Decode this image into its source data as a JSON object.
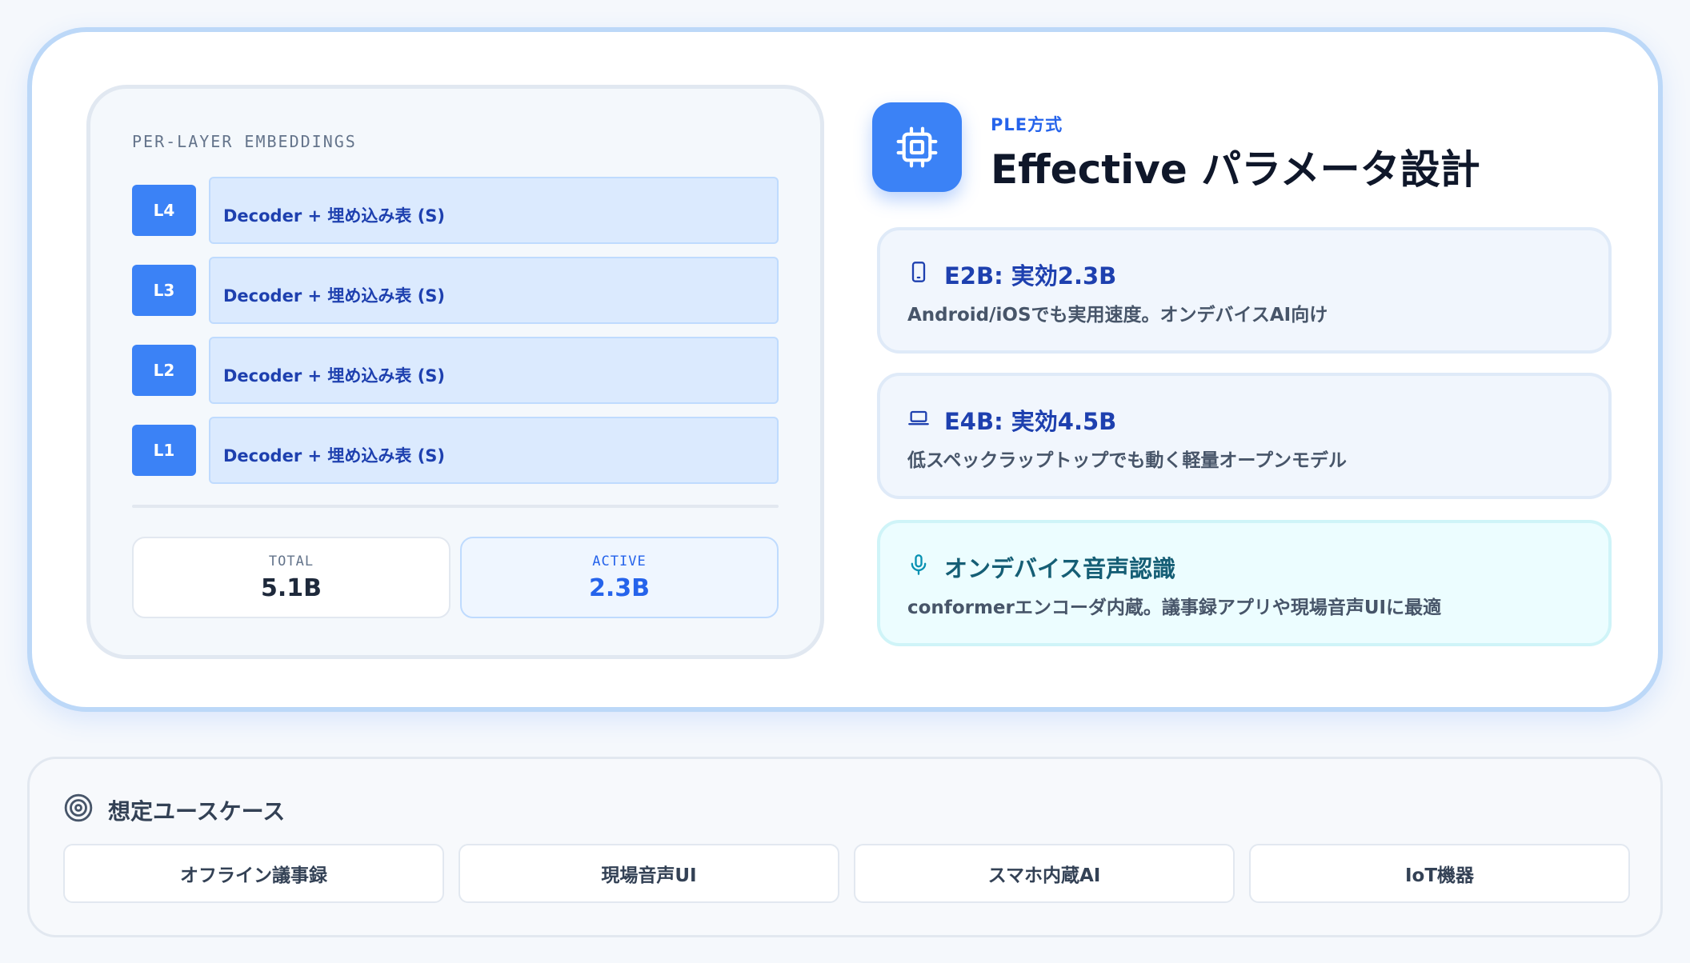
{
  "diagram": {
    "heading": "PER-LAYER EMBEDDINGS",
    "layers": [
      {
        "badge": "L4",
        "label": "Decoder + 埋め込み表 (S)"
      },
      {
        "badge": "L3",
        "label": "Decoder + 埋め込み表 (S)"
      },
      {
        "badge": "L2",
        "label": "Decoder + 埋め込み表 (S)"
      },
      {
        "badge": "L1",
        "label": "Decoder + 埋め込み表 (S)"
      }
    ],
    "stats": {
      "total": {
        "label": "TOTAL",
        "value": "5.1B"
      },
      "active": {
        "label": "ACTIVE",
        "value": "2.3B"
      }
    }
  },
  "header": {
    "icon": "chip-icon",
    "eyebrow": "PLE方式",
    "title": "Effective パラメータ設計"
  },
  "features": [
    {
      "icon": "smartphone-icon",
      "title": "E2B: 実効2.3B",
      "desc": "Android/iOSでも実用速度。オンデバイスAI向け"
    },
    {
      "icon": "laptop-icon",
      "title": "E4B: 実効4.5B",
      "desc": "低スペックラップトップでも動く軽量オープンモデル"
    },
    {
      "icon": "microphone-icon",
      "title": "オンデバイス音声認識",
      "desc": "conformerエンコーダ内蔵。議事録アプリや現場音声UIに最適"
    }
  ],
  "usecases": {
    "icon": "target-icon",
    "heading": "想定ユースケース",
    "items": [
      "オフライン議事録",
      "現場音声UI",
      "スマホ内蔵AI",
      "IoT機器"
    ]
  },
  "colors": {
    "accent": "#3b82f6",
    "accent_dark": "#1e40af",
    "cyan_title": "#155e75",
    "card_border": "#bcd8f8"
  }
}
